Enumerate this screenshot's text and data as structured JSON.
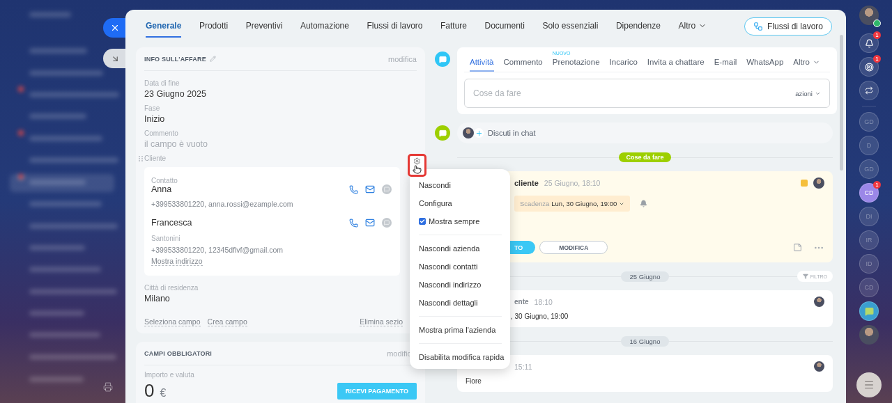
{
  "tabs": [
    {
      "label": "Generale",
      "selected": true
    },
    {
      "label": "Prodotti",
      "selected": false
    },
    {
      "label": "Preventivi",
      "selected": false
    },
    {
      "label": "Automazione",
      "selected": false
    },
    {
      "label": "Flussi di lavoro",
      "selected": false
    },
    {
      "label": "Fatture",
      "selected": false
    },
    {
      "label": "Documenti",
      "selected": false
    },
    {
      "label": "Solo essenziali",
      "selected": false
    },
    {
      "label": "Dipendenze",
      "selected": false
    }
  ],
  "tabs_more": "Altro",
  "flow_button": "Flussi di lavoro",
  "deal_info": {
    "title": "INFO SULL'AFFARE",
    "edit": "modifica",
    "fields": [
      {
        "label": "Data di fine",
        "value": "23 Giugno 2025",
        "kind": "value"
      },
      {
        "label": "Fase",
        "value": "Inizio",
        "kind": "value"
      },
      {
        "label": "Commento",
        "value": "il campo è vuoto",
        "kind": "empty"
      }
    ],
    "client": {
      "label": "Cliente",
      "contacts": [
        {
          "role": "Contatto",
          "name": "Anna",
          "details": "+399533801220, anna.rossi@ezample.com"
        },
        {
          "name": "Francesca",
          "subtitle": "Santonini",
          "details": "+399533801220, 12345dflvf@gmail.com",
          "link": "Mostra indirizzo"
        }
      ]
    },
    "city": {
      "label": "Città di residenza",
      "value": "Milano"
    },
    "links": [
      "Seleziona campo",
      "Crea campo"
    ],
    "delete": "Elimina sezio"
  },
  "required": {
    "title": "CAMPI OBBLIGATORI",
    "edit": "modific",
    "label": "Importo e valuta",
    "amount": "0",
    "currency": "€",
    "pay_button": "RICEVI PAGAMENTO"
  },
  "context_menu": {
    "items": [
      {
        "kind": "item",
        "label": "Nascondi"
      },
      {
        "kind": "item",
        "label": "Configura"
      },
      {
        "kind": "check",
        "label": "Mostra sempre",
        "checked": true
      },
      {
        "kind": "divider"
      },
      {
        "kind": "item",
        "label": "Nascondi azienda"
      },
      {
        "kind": "item",
        "label": "Nascondi contatti"
      },
      {
        "kind": "item",
        "label": "Nascondi indirizzo"
      },
      {
        "kind": "item",
        "label": "Nascondi dettagli"
      },
      {
        "kind": "divider"
      },
      {
        "kind": "item",
        "label": "Mostra prima l'azienda"
      },
      {
        "kind": "divider"
      },
      {
        "kind": "item",
        "label": "Disabilita modifica rapida"
      }
    ]
  },
  "composer": {
    "tabs": [
      {
        "label": "Attività",
        "selected": true
      },
      {
        "label": "Commento",
        "selected": false
      },
      {
        "label": "Prenotazione",
        "selected": false,
        "badge": "NUOVO"
      },
      {
        "label": "Incarico",
        "selected": false
      },
      {
        "label": "Invita a chattare",
        "selected": false
      },
      {
        "label": "E-mail",
        "selected": false
      },
      {
        "label": "WhatsApp",
        "selected": false
      }
    ],
    "more": "Altro",
    "placeholder": "Cose da fare",
    "actions": "azioni"
  },
  "chat_row": "Discuti in chat",
  "todo_divider": "Cose da fare",
  "activity": {
    "title": "cliente",
    "time": "25 Giugno, 18:10",
    "deadline_label": "Scadenza",
    "deadline": "Lun, 30 Giugno, 19:00",
    "done_button": "TO",
    "edit_button": "MODIFICA"
  },
  "history": [
    {
      "date": "25 Giugno",
      "filter": "FILTRO",
      "title": "ente",
      "time": "18:10",
      "text": ", 30 Giugno, 19:00"
    },
    {
      "date": "16 Giugno",
      "time": "15:11",
      "text": "Fiore"
    }
  ],
  "rail": {
    "notifications_badge": "1",
    "goals_badge": "1",
    "chats": [
      {
        "initials": "GD",
        "selected": false
      },
      {
        "initials": "D",
        "selected": false
      },
      {
        "initials": "GD",
        "selected": false
      },
      {
        "initials": "CD",
        "selected": true,
        "badge": "1"
      },
      {
        "initials": "DI",
        "selected": false
      },
      {
        "initials": "IR",
        "selected": false
      },
      {
        "initials": "ID",
        "selected": false
      },
      {
        "initials": "CD",
        "selected": false
      }
    ]
  }
}
